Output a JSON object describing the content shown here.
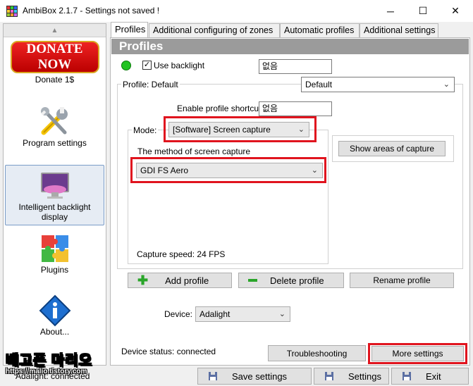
{
  "window": {
    "title": "AmbiBox 2.1.7  - Settings not saved !",
    "minimize": "─",
    "maximize": "☐",
    "close": "✕"
  },
  "sidebar": {
    "scroll_up": "▲",
    "donate_logo": "DONATE NOW",
    "items": [
      {
        "label": "Donate 1$"
      },
      {
        "label": "Program settings"
      },
      {
        "label": "Intelligent backlight display"
      },
      {
        "label": "Plugins"
      },
      {
        "label": "About..."
      }
    ]
  },
  "tabs": [
    {
      "label": "Profiles"
    },
    {
      "label": "Additional configuring of zones"
    },
    {
      "label": "Automatic profiles"
    },
    {
      "label": "Additional settings"
    }
  ],
  "profiles": {
    "header": "Profiles",
    "use_backlight_label": "Use backlight",
    "use_backlight_checked": true,
    "backlight_shortcut_value": "없음",
    "profile_label": "Profile: Default",
    "profile_select": "Default",
    "enable_shortcut_label": "Enable profile shortcut:",
    "enable_shortcut_value": "없음",
    "mode_label": "Mode:",
    "mode_select": "[Software] Screen capture",
    "show_areas_button": "Show areas of capture",
    "capture_method_label": "The method of screen capture",
    "capture_method_select": "GDI FS Aero",
    "capture_speed": "Capture speed: 24 FPS",
    "add_profile": "Add profile",
    "delete_profile": "Delete profile",
    "rename_profile": "Rename profile",
    "device_label": "Device:",
    "device_select": "Adalight",
    "device_status": "Device status: connected",
    "troubleshooting": "Troubleshooting",
    "more_settings": "More settings"
  },
  "bottom": {
    "status": "Adalight: connected",
    "save_settings": "Save settings",
    "settings": "Settings",
    "exit": "Exit"
  },
  "watermark": {
    "title": "배고픈 마리오",
    "url": "https://malio.tistory.com"
  },
  "colors": {
    "highlight_red": "#e0141e",
    "status_green": "#22c322",
    "header_gray": "#9b9b9b"
  }
}
